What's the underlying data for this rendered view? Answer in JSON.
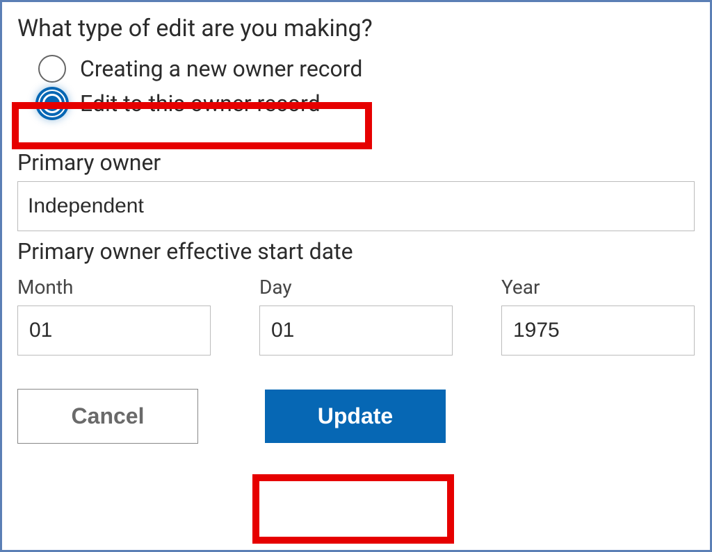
{
  "question": "What type of edit are you making?",
  "radio": {
    "option1": "Creating a new owner record",
    "option2": "Edit to this owner record"
  },
  "primaryOwner": {
    "label": "Primary owner",
    "value": "Independent"
  },
  "effectiveDate": {
    "label": "Primary owner effective start date",
    "month": {
      "label": "Month",
      "value": "01"
    },
    "day": {
      "label": "Day",
      "value": "01"
    },
    "year": {
      "label": "Year",
      "value": "1975"
    }
  },
  "buttons": {
    "cancel": "Cancel",
    "update": "Update"
  },
  "colors": {
    "accent": "#0667b4",
    "highlight": "#e60000",
    "border": "#5b7fb5"
  }
}
